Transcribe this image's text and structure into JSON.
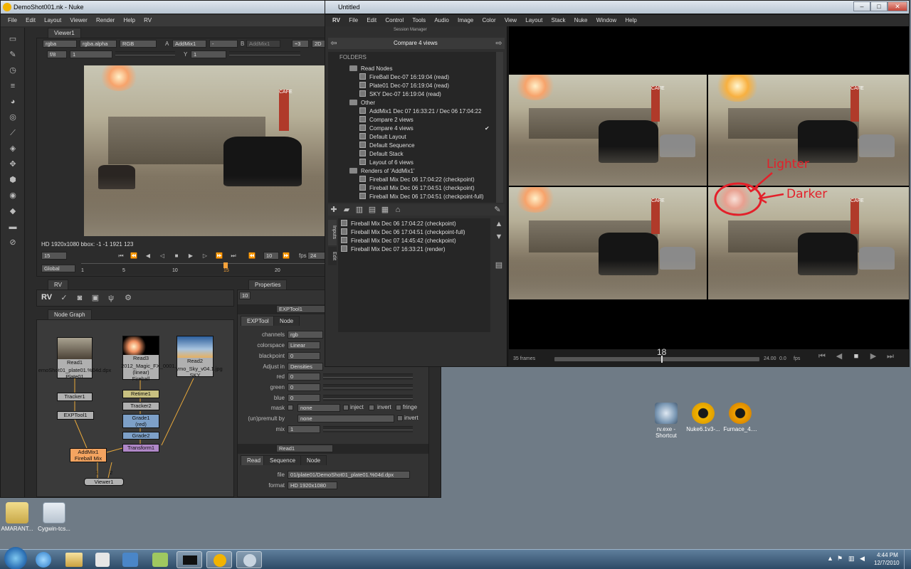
{
  "nuke": {
    "title": "DemoShot001.nk - Nuke",
    "menu": [
      "File",
      "Edit",
      "Layout",
      "Viewer",
      "Render",
      "Help",
      "RV"
    ],
    "viewer": {
      "tab": "Viewer1",
      "channels": "rgba",
      "alpha": "rgba.alpha",
      "colorspace": "RGB",
      "a_label": "A",
      "a_input": "AddMix1",
      "dash": "-",
      "b_label": "B",
      "b_input": "AddMix1",
      "zoom": "÷3",
      "mode": "2D",
      "fstop": "f/8",
      "gain": "1",
      "y_label": "Y",
      "y_val": "1",
      "info": "HD 1920x1080 bbox: -1 -1 1921 123",
      "frame": "15",
      "inc": "10",
      "fps_label": "fps",
      "fps": "24",
      "range": "Global",
      "ticks": [
        "1",
        "5",
        "10",
        "15",
        "20"
      ]
    },
    "rv_panel": {
      "tab": "RV",
      "label": "RV"
    },
    "nodegraph": {
      "tab": "Node Graph",
      "nodes": {
        "read1": "Read1",
        "read1_file": "emoShot01_plate01.%04d.dpx",
        "read1_sub": "Plate01",
        "read3": "Read3",
        "read3_file": "2012_Magic_FX_0001.1",
        "read3_cs": "(linear)",
        "read3_sub": "Fireball",
        "read2": "Read2",
        "read2_file": "ymo_Sky_v04.1.jpg",
        "read2_sub": "SKY",
        "tracker1": "Tracker1",
        "exptool1": "EXPTool1",
        "retime1": "Retime1",
        "tracker2": "Tracker2",
        "grade1": "Grade1",
        "grade1_sub": "(red)",
        "grade2": "Grade2",
        "transform1": "Transform1",
        "addmix1": "AddMix1",
        "addmix1_sub": "Fireball Mix",
        "viewer1": "Viewer1",
        "in1": "1",
        "in2": "2"
      }
    },
    "properties": {
      "tab": "Properties",
      "count": "10",
      "exptool": {
        "name": "EXPTool1",
        "tabs": [
          "EXPTool",
          "Node"
        ],
        "channels_l": "channels",
        "channels": "rgb",
        "colorspace_l": "colorspace",
        "colorspace": "Linear",
        "blackpoint_l": "blackpoint",
        "blackpoint": "0",
        "adjust_l": "Adjust in",
        "adjust": "Densities",
        "red_l": "red",
        "red": "0",
        "green_l": "green",
        "green": "0",
        "blue_l": "blue",
        "blue": "0",
        "mask_l": "mask",
        "mask": "none",
        "inject": "inject",
        "invert": "invert",
        "fringe": "fringe",
        "unpremult_l": "(un)premult by",
        "unpremult": "none",
        "invert2": "invert",
        "mix_l": "mix",
        "mix": "1"
      },
      "read": {
        "name": "Read1",
        "tabs": [
          "Read",
          "Sequence",
          "Node"
        ],
        "file_l": "file",
        "file": "01/plate01/DemoShot01_plate01.%04d.dpx",
        "format_l": "format",
        "format": "HD 1920x1080"
      }
    }
  },
  "rv": {
    "title": "Untitled",
    "menu": [
      "RV",
      "File",
      "Edit",
      "Control",
      "Tools",
      "Audio",
      "Image",
      "Color",
      "View",
      "Layout",
      "Stack",
      "Nuke",
      "Window",
      "Help"
    ],
    "session": {
      "header": "Session Manager",
      "current": "Compare 4 views",
      "folders": "FOLDERS",
      "groups": [
        {
          "name": "Read Nodes",
          "items": [
            "FireBall        Dec-07 16:19:04 (read)",
            "Plate01 Dec-07 16:19:04 (read)",
            "SKY Dec-07 16:19:04 (read)"
          ]
        },
        {
          "name": "Other",
          "items": [
            "AddMix1  Dec 07 16:33:21 / Dec 06 17:04:22",
            "Compare 2 views",
            "Compare 4 views",
            "Default Layout",
            "Default Sequence",
            "Default Stack",
            "Layout of 6 views"
          ]
        },
        {
          "name": "Renders of 'AddMix1'",
          "items": [
            "Fireball Mix Dec 06 17:04:22 (checkpoint)",
            "Fireball Mix Dec 06 17:04:51 (checkpoint)",
            "Fireball Mix Dec 06 17:04:51 (checkpoint-full)"
          ]
        }
      ],
      "check": "✔",
      "side_tabs": [
        "Inputs",
        "Edit"
      ],
      "inputs": [
        "Fireball Mix Dec 06 17:04:22 (checkpoint)",
        "Fireball Mix Dec 06 17:04:51 (checkpoint-full)",
        "Fireball Mix Dec 07 14:45:42 (checkpoint)",
        "Fireball Mix Dec 07 16:33:21 (render)"
      ]
    },
    "annotations": {
      "lighter": "Lighter",
      "darker": "Darker"
    },
    "timeline": {
      "frames": "35 frames",
      "frame": "18",
      "fps_val": "24.00",
      "fps_a": "0.0",
      "fps_l": "fps"
    }
  },
  "desktop": {
    "icons": [
      {
        "label": "rv.exe -\nShortcut",
        "id": "rv"
      },
      {
        "label": "Nuke6.1v3-...",
        "id": "nuke"
      },
      {
        "label": "Furnace_4....",
        "id": "furnace"
      },
      {
        "label": "AMARANT...",
        "id": "amarant"
      },
      {
        "label": "Cygwin-tcs...",
        "id": "cygwin"
      }
    ]
  },
  "taskbar": {
    "time": "4:44 PM",
    "date": "12/7/2010"
  },
  "colors": {
    "rv_red": "#e3202a",
    "desktop": "#6f7b86",
    "panel": "#333333",
    "node_read": "#b0b0b0",
    "node_grade": "#7da0c8",
    "node_merge": "#f4a460",
    "node_transform": "#b088c8"
  }
}
